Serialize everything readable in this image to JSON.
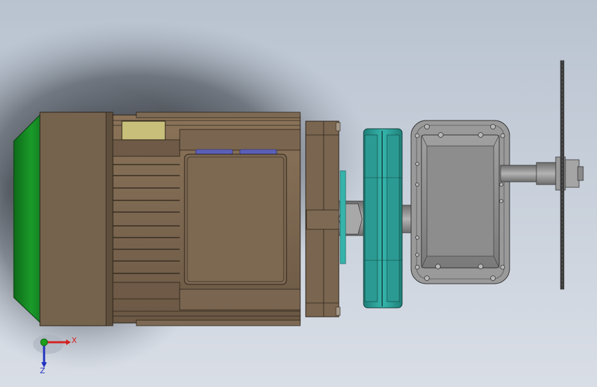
{
  "triad": {
    "x_label": "X",
    "z_label": "Z"
  },
  "colors": {
    "background_top": "#b9c3d0",
    "background_bottom": "#d9dee6",
    "motor_body": "#7b6650",
    "motor_fan_cover": "#1a8f2a",
    "nameplate": "#c8c07a",
    "pulley": "#2fa8a0",
    "gearbox": "#8c8c8c",
    "saw_blade": "#3c3c3c",
    "axis_x": "#d42020",
    "axis_y": "#1aa01a",
    "axis_z": "#2030c0"
  },
  "components": [
    {
      "id": "fan-cover",
      "icon": "green-fan-cover"
    },
    {
      "id": "motor-housing",
      "icon": "finned-motor-body"
    },
    {
      "id": "terminal-box",
      "icon": "nameplate"
    },
    {
      "id": "motor-flange",
      "icon": "flange"
    },
    {
      "id": "double-v-pulley",
      "icon": "pulley"
    },
    {
      "id": "gearbox",
      "icon": "gear-housing"
    },
    {
      "id": "output-shaft",
      "icon": "shaft"
    },
    {
      "id": "saw-blade",
      "icon": "circular-blade"
    }
  ]
}
